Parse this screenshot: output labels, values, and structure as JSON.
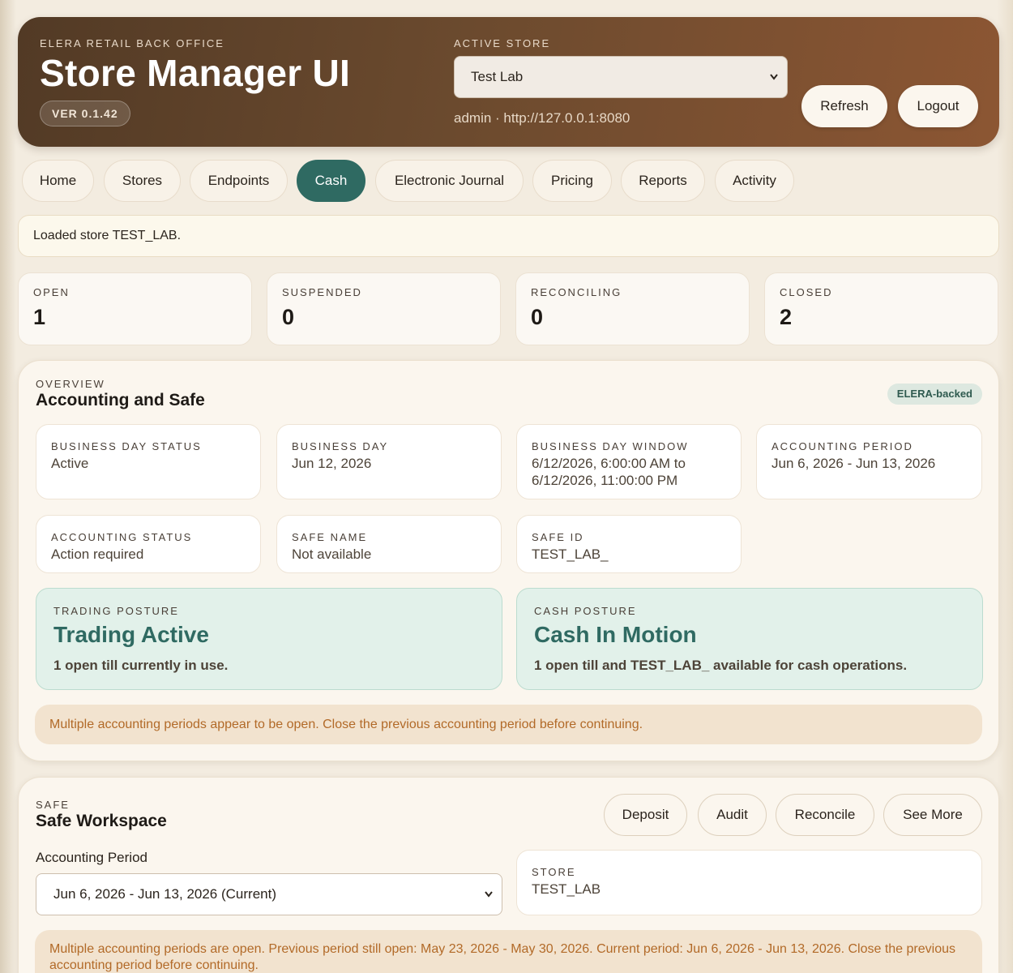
{
  "header": {
    "brand_eyebrow": "ELERA RETAIL BACK OFFICE",
    "title": "Store Manager UI",
    "version": "VER 0.1.42",
    "store_eyebrow": "ACTIVE STORE",
    "store_selected": "Test Lab",
    "session_info": "admin · http://127.0.0.1:8080",
    "refresh_label": "Refresh",
    "logout_label": "Logout"
  },
  "nav": {
    "tabs": [
      "Home",
      "Stores",
      "Endpoints",
      "Cash",
      "Electronic Journal",
      "Pricing",
      "Reports",
      "Activity"
    ],
    "active": "Cash"
  },
  "status_message": "Loaded store TEST_LAB.",
  "stats": [
    {
      "label": "OPEN",
      "value": "1"
    },
    {
      "label": "SUSPENDED",
      "value": "0"
    },
    {
      "label": "RECONCILING",
      "value": "0"
    },
    {
      "label": "CLOSED",
      "value": "2"
    }
  ],
  "overview": {
    "eyebrow": "OVERVIEW",
    "title": "Accounting and Safe",
    "badge": "ELERA-backed",
    "cards": [
      {
        "label": "BUSINESS DAY STATUS",
        "value": "Active"
      },
      {
        "label": "BUSINESS DAY",
        "value": "Jun 12, 2026"
      },
      {
        "label": "BUSINESS DAY WINDOW",
        "value": "6/12/2026, 6:00:00 AM to 6/12/2026, 11:00:00 PM"
      },
      {
        "label": "ACCOUNTING PERIOD",
        "value": "Jun 6, 2026 - Jun 13, 2026"
      },
      {
        "label": "ACCOUNTING STATUS",
        "value": "Action required"
      },
      {
        "label": "SAFE NAME",
        "value": "Not available"
      },
      {
        "label": "SAFE ID",
        "value": "TEST_LAB_"
      }
    ],
    "trading": {
      "label": "TRADING POSTURE",
      "title": "Trading Active",
      "desc": "1 open till currently in use."
    },
    "cash": {
      "label": "CASH POSTURE",
      "title": "Cash In Motion",
      "desc": "1 open till and TEST_LAB_ available for cash operations."
    },
    "warning": "Multiple accounting periods appear to be open. Close the previous accounting period before continuing."
  },
  "safe": {
    "eyebrow": "SAFE",
    "title": "Safe Workspace",
    "buttons": [
      "Deposit",
      "Audit",
      "Reconcile",
      "See More"
    ],
    "period_label": "Accounting Period",
    "period_selected": "Jun 6, 2026 - Jun 13, 2026 (Current)",
    "store_label": "STORE",
    "store_value": "TEST_LAB",
    "warning": "Multiple accounting periods are open. Previous period still open: May 23, 2026 - May 30, 2026. Current period: Jun 6, 2026 - Jun 13, 2026. Close the previous accounting period before continuing."
  },
  "colors": {
    "header_gradient_start": "#523a25",
    "header_gradient_end": "#8c5633",
    "accent_teal": "#2f6a62",
    "warning_text": "#b26a28",
    "posture_bg": "#e2f1ea"
  }
}
